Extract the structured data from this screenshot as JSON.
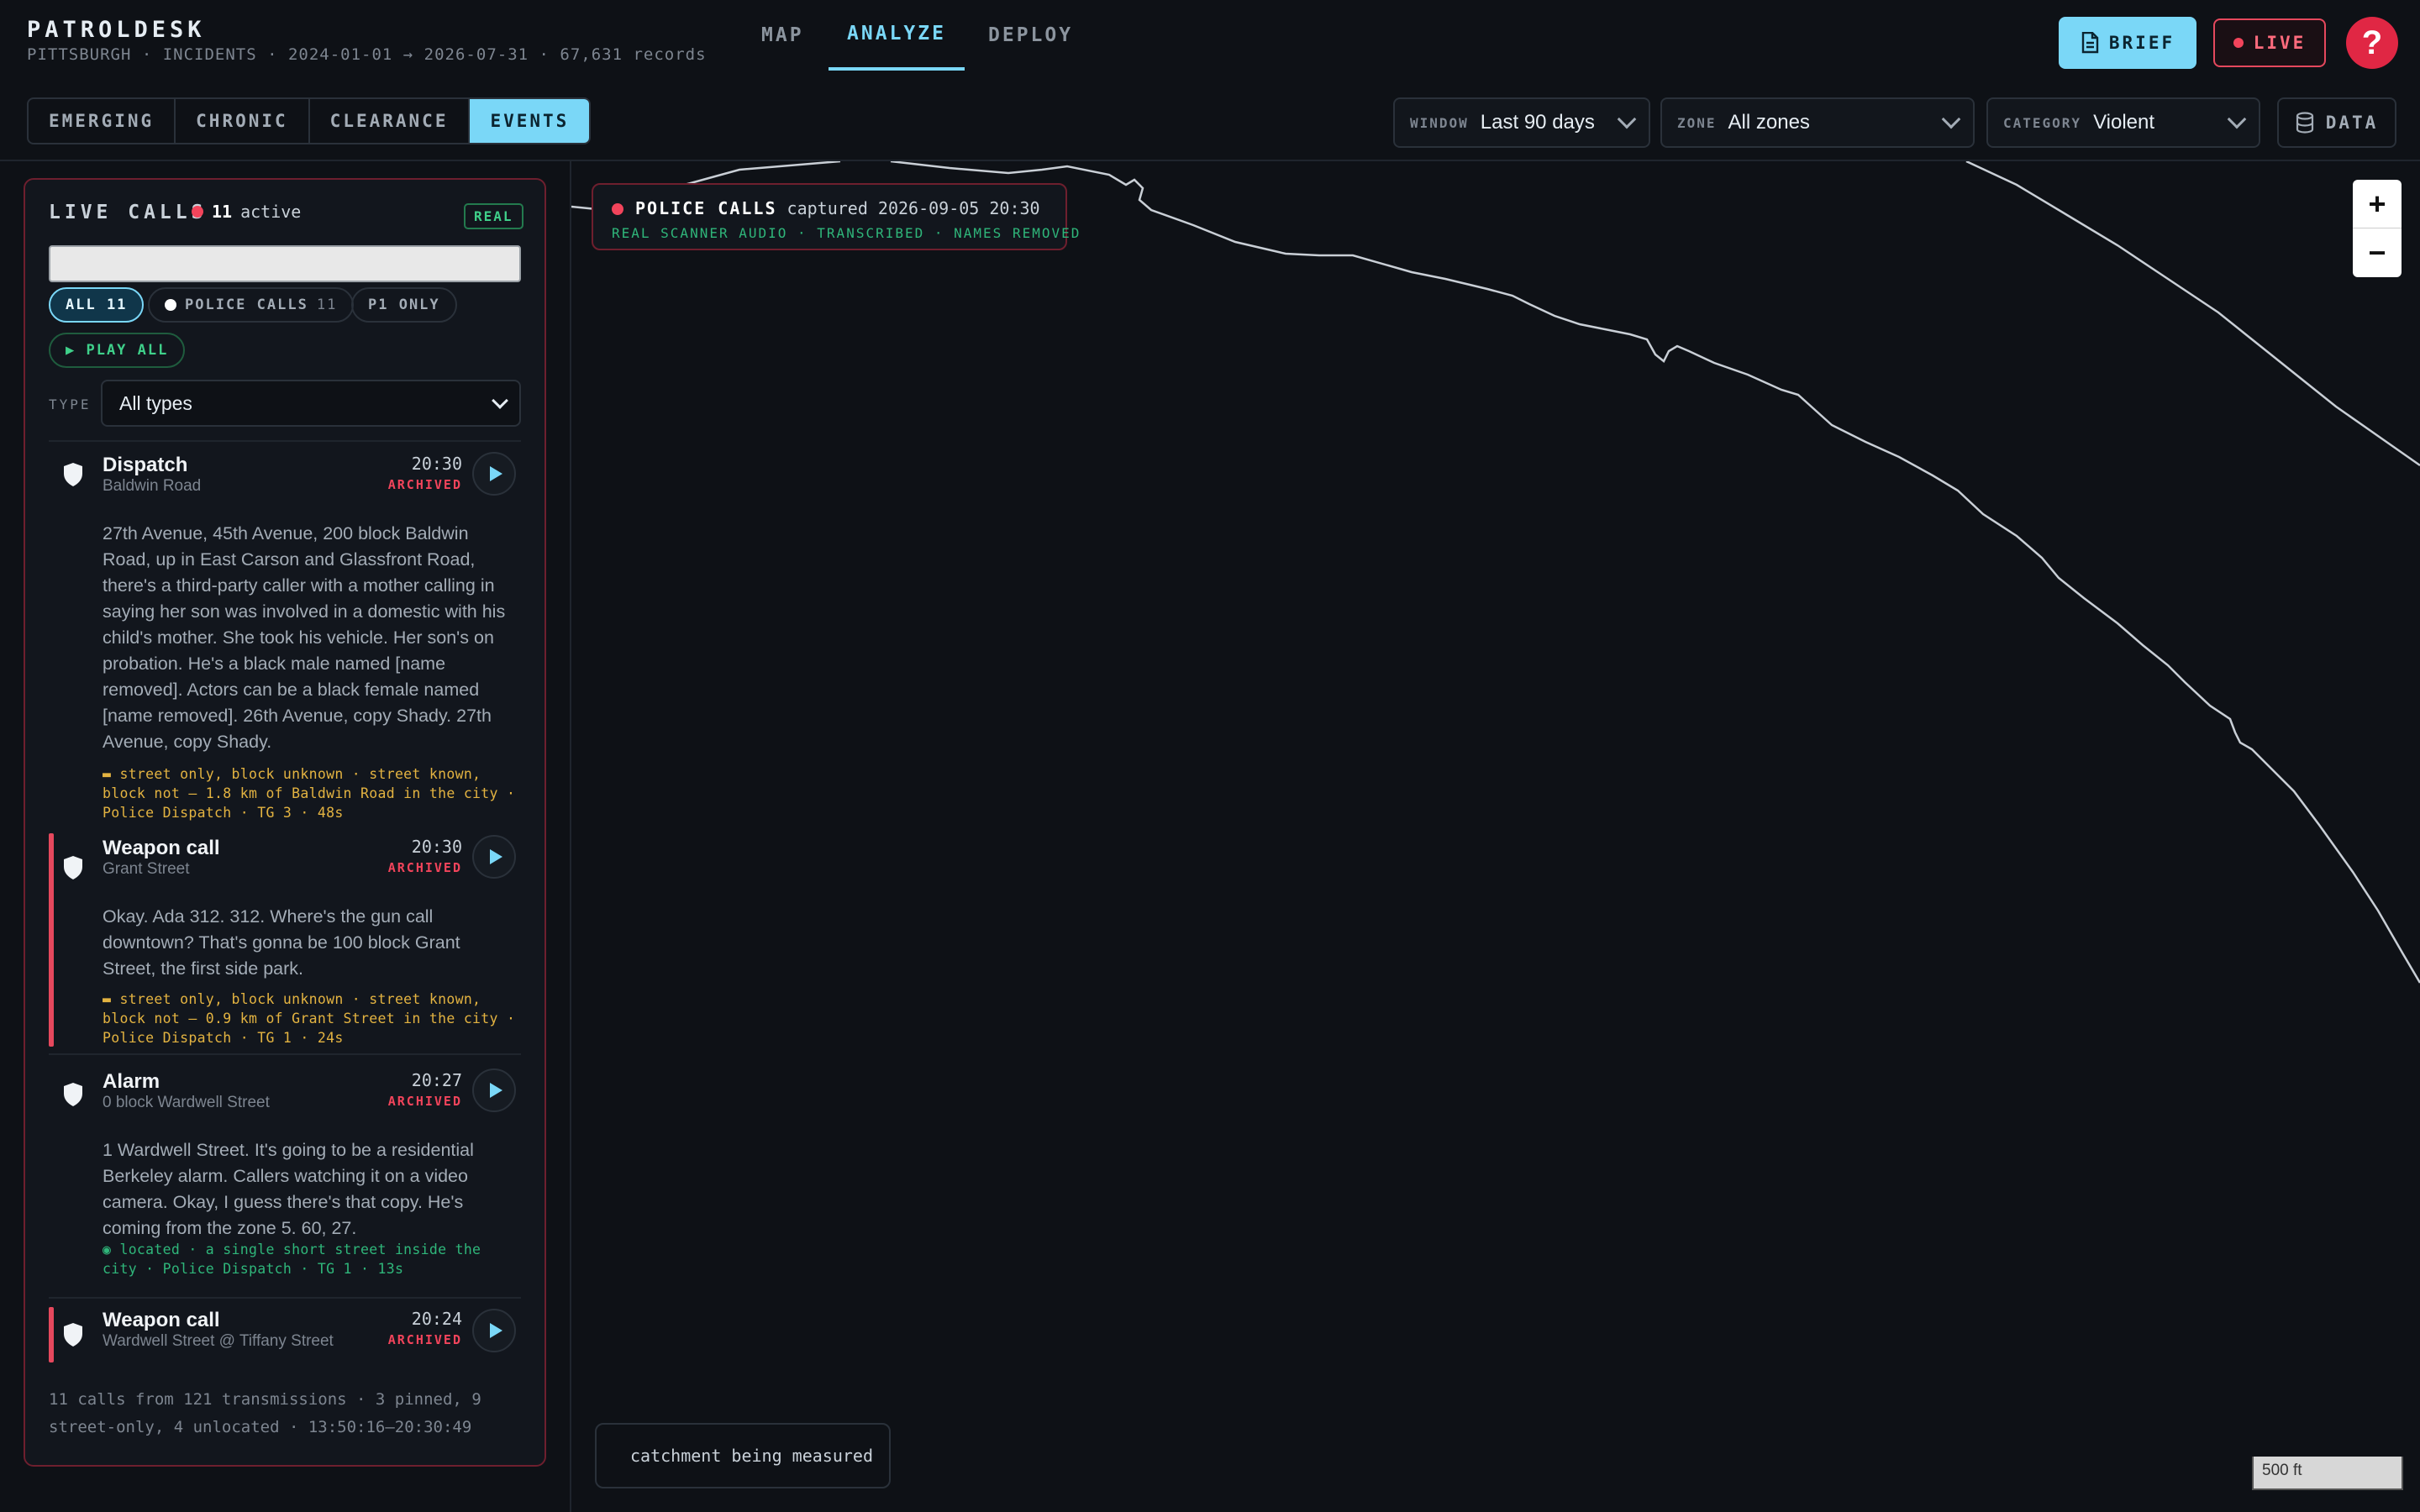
{
  "app": {
    "brand": "PATROLDESK",
    "subtitle": "PITTSBURGH · INCIDENTS · 2024-01-01 → 2026-07-31 · 67,631 records"
  },
  "nav": {
    "map": "MAP",
    "analyze": "ANALYZE",
    "deploy": "DEPLOY",
    "active": "ANALYZE"
  },
  "header_actions": {
    "brief": "BRIEF",
    "live": "LIVE",
    "help": "?"
  },
  "tabs": [
    "EMERGING",
    "CHRONIC",
    "CLEARANCE",
    "EVENTS"
  ],
  "active_tab": "EVENTS",
  "filters": {
    "window": {
      "label": "WINDOW",
      "value": "Last 90 days"
    },
    "zone": {
      "label": "ZONE",
      "value": "All zones"
    },
    "category": {
      "label": "CATEGORY",
      "value": "Violent"
    }
  },
  "data_button": "DATA",
  "live_calls": {
    "title": "LIVE CALLS",
    "active_count": "11",
    "active_label": "active",
    "badge": "REAL",
    "chips": {
      "all": "ALL 11",
      "police_calls": "POLICE CALLS",
      "police_calls_count": "11",
      "p1_only": "P1 ONLY",
      "play_all": "▶ PLAY ALL"
    },
    "type_filter": {
      "label": "TYPE",
      "value": "All types"
    },
    "calls": [
      {
        "title": "Dispatch",
        "location": "Baldwin Road",
        "time": "20:30",
        "status": "ARCHIVED",
        "icon": "shield-icon",
        "text": "27th Avenue, 45th Avenue, 200 block Baldwin Road, up in East Carson and Glassfront Road, there's a third-party caller with a mother calling in saying her son was involved in a domestic with his child's mother. She took his vehicle. Her son's on probation. He's a black male named [name removed]. Actors can be a black female named [name removed]. 26th Avenue, copy Shady. 27th Avenue, copy Shady.",
        "meta": "▬ street only, block unknown · street known, block not — 1.8 km of Baldwin Road in the city · Police Dispatch · TG 3 · 48s"
      },
      {
        "title": "Weapon call",
        "location": "Grant Street",
        "time": "20:30",
        "status": "ARCHIVED",
        "icon": "shield-icon",
        "text": "Okay. Ada 312. 312. Where's the gun call downtown? That's gonna be 100 block Grant Street, the first side park.",
        "meta": "▬ street only, block unknown · street known, block not — 0.9 km of Grant Street in the city · Police Dispatch · TG 1 · 24s"
      },
      {
        "title": "Alarm",
        "location": "0 block Wardwell Street",
        "time": "20:27",
        "status": "ARCHIVED",
        "icon": "shield-icon",
        "text": "1 Wardwell Street. It's going to be a residential Berkeley alarm. Callers watching it on a video camera. Okay, I guess there's that copy. He's coming from the zone 5. 60, 27.",
        "meta": "◉ located · a single short street inside the city · Police Dispatch · TG 1 · 13s"
      },
      {
        "title": "Weapon call",
        "location": "Wardwell Street @ Tiffany Street",
        "time": "20:24",
        "status": "ARCHIVED",
        "icon": "shield-icon"
      }
    ],
    "footer": "11 calls from 121 transmissions · 3 pinned, 9 street-only, 4 unlocated · 13:50:16–20:30:49"
  },
  "map": {
    "banner_title": "POLICE CALLS",
    "banner_captured": "captured 2026-09-05 20:30",
    "banner_sub": "REAL SCANNER AUDIO · TRANSCRIBED · NAMES REMOVED",
    "zoom_in": "+",
    "zoom_out": "−",
    "catchment": "catchment being measured",
    "scale": "500 ft"
  },
  "colors": {
    "accent": "#7ad7f7",
    "live": "#f2445b",
    "street_only": "#e3b341",
    "located": "#2fb67a",
    "background": "#0e1116"
  }
}
